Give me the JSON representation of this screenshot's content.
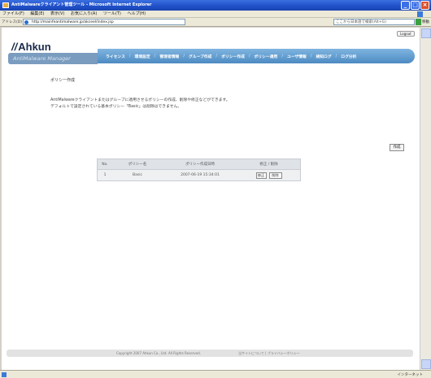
{
  "window": {
    "title": "AntiMalwareクライアント管理ツール - Microsoft Internet Explorer"
  },
  "menubar": {
    "items": [
      "ファイル(F)",
      "編集(E)",
      "表示(V)",
      "お気に入り(A)",
      "ツール(T)",
      "ヘルプ(H)"
    ]
  },
  "addressbar": {
    "label": "アドレス(D)",
    "url": "http://mainfeantimalware.jp/akceel/index.jsp",
    "search_placeholder": "ここから日本語で検索(Alt+G)",
    "go_label": "移動"
  },
  "page": {
    "logout_label": "Logout",
    "logo_text": "Ahkun",
    "subbrand": "AntiMalware Manager",
    "nav": [
      "ライセンス",
      "環境設定",
      "管理者情報",
      "グループ作成",
      "ポリシー作成",
      "ポリシー適用",
      "ユーザ情報",
      "検知ログ",
      "ログ分析"
    ],
    "title": "ポリシー作成",
    "desc1": "AntiMalwareクライアントまたはグループに適用させるポリシーの作成、削除や修正などができます。",
    "desc2": "デフォルトで設定されている基本ポリシー「Basic」は削除はできません。",
    "create_button": "作成"
  },
  "policy_table": {
    "headers": {
      "no": "No.",
      "name": "ポリシー名",
      "date": "ポリシー作成日時",
      "actions": "修正 / 削除"
    },
    "rows": [
      {
        "no": "1",
        "name": "Basic",
        "date": "2007-06-19 15:34:01",
        "edit": "修正",
        "delete": "削除"
      }
    ]
  },
  "footer": {
    "copyright": "Copyright 2007 Ahkun Co., Ltd. All Rights Reserved.",
    "links": "当サイトについて | プライバシーポリシー"
  },
  "statusbar": {
    "zone": "インターネット"
  }
}
